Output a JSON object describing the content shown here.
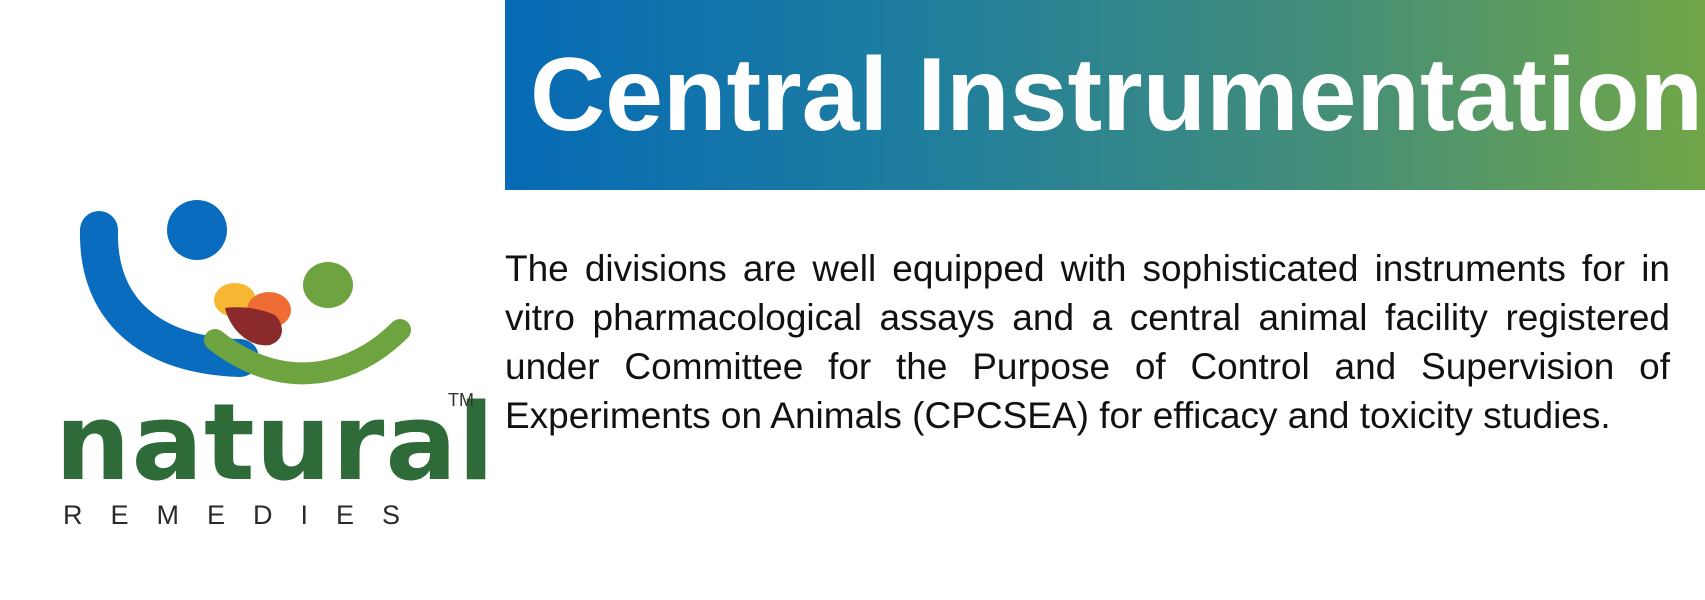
{
  "header": {
    "title": "Central Instrumentation"
  },
  "logo": {
    "wordmark": "natural",
    "tagline": "REMEDIES",
    "trademark": "TM",
    "colors": {
      "blue": "#0a6cbf",
      "green": "#6ea43f",
      "yellow": "#f7b733",
      "orange": "#ef6c34",
      "maroon": "#8b2a2a",
      "wordmark": "#2f6a39"
    }
  },
  "content": {
    "paragraph": "The divisions are well equipped with sophisticated instruments for in vitro pharmacological assays and a central animal facility registered under Committee for the Purpose of Control and Supervision of Experiments on Animals (CPCSEA) for efficacy and toxicity studies."
  },
  "colors": {
    "banner_start": "#066ab5",
    "banner_end": "#70a648",
    "banner_text": "#ffffff",
    "body_text": "#111111"
  }
}
